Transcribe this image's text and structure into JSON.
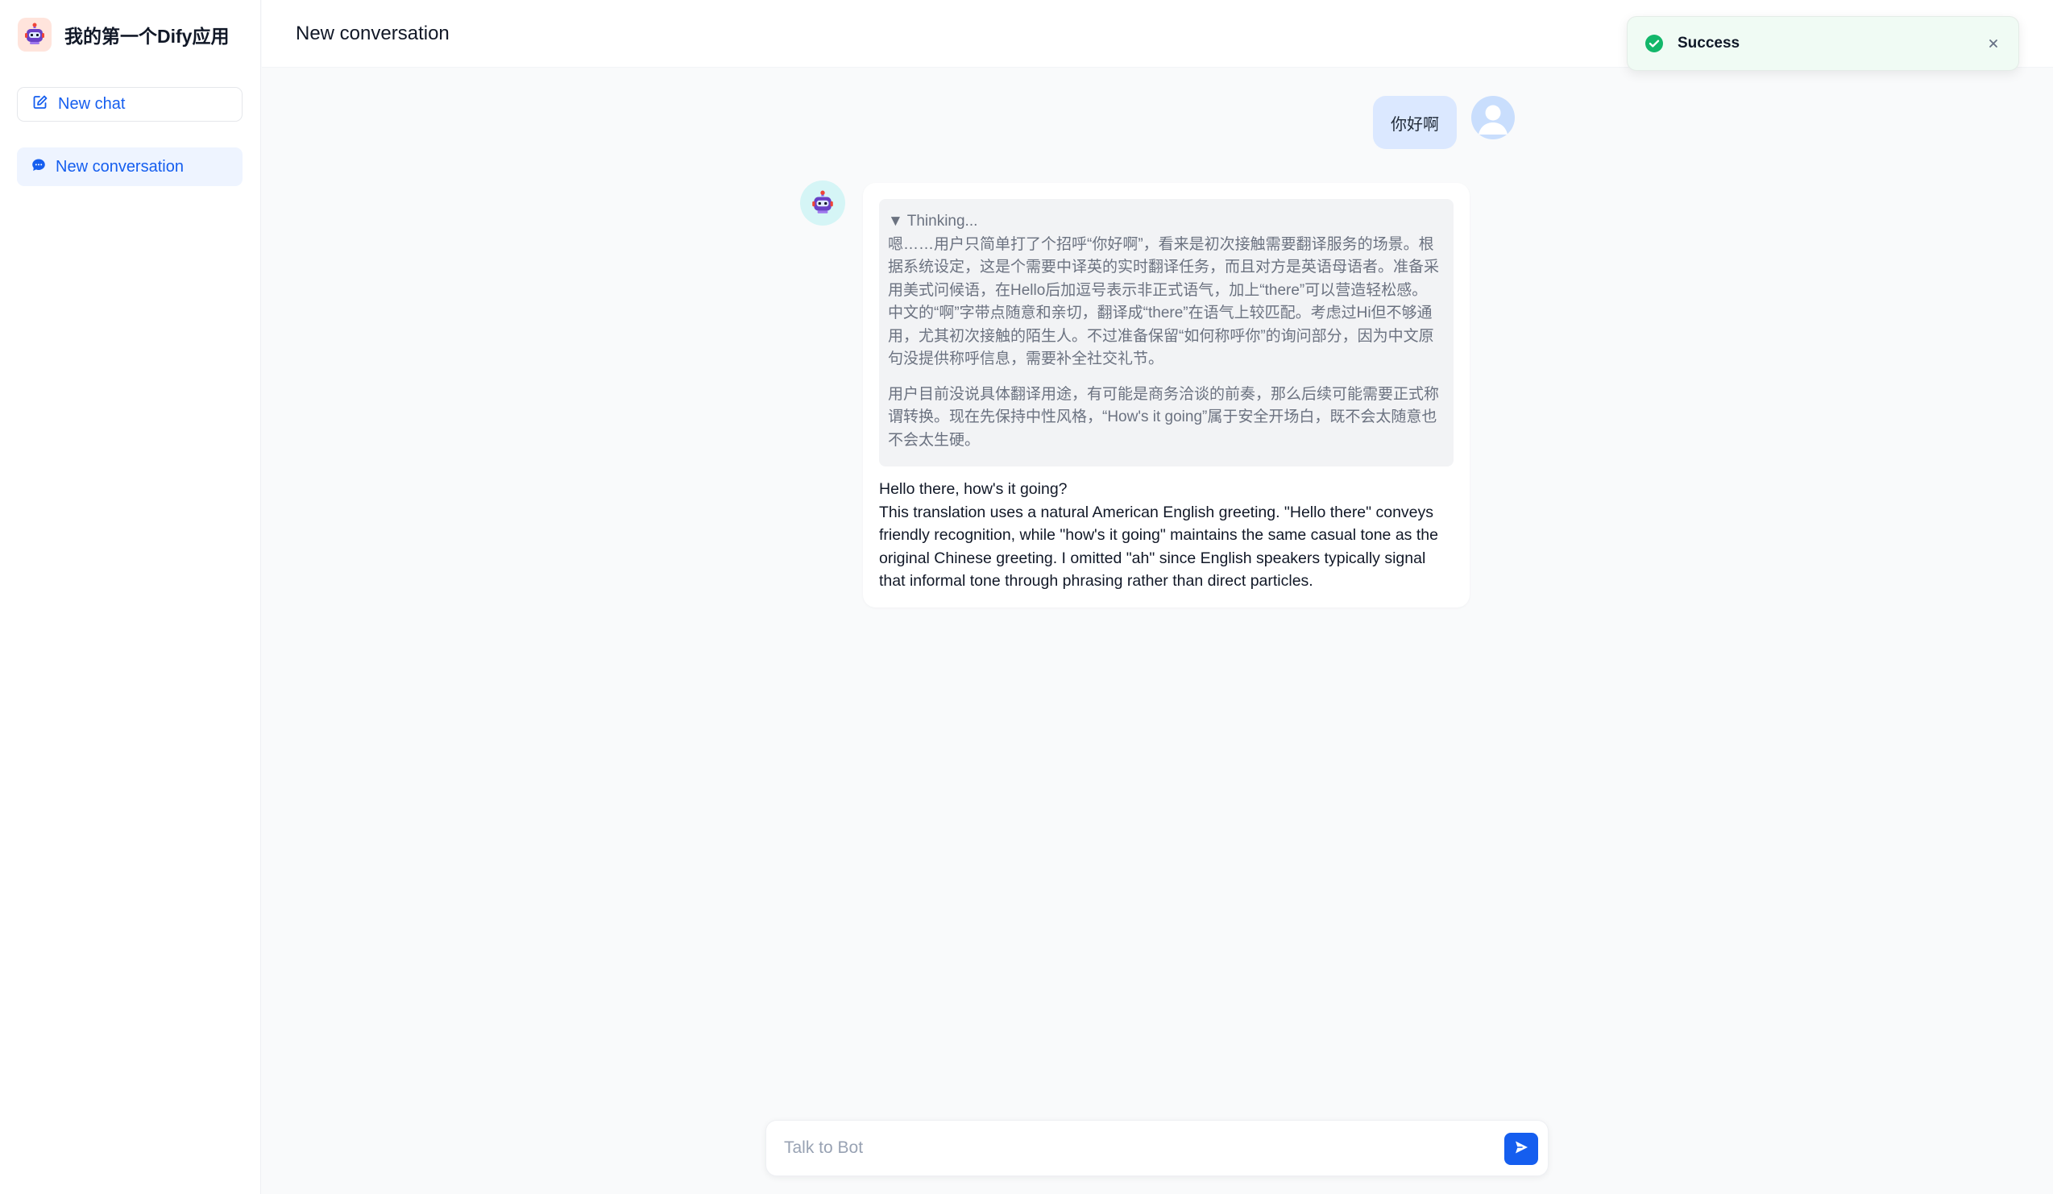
{
  "app": {
    "title": "我的第一个Dify应用",
    "logo_icon": "robot-icon"
  },
  "sidebar": {
    "new_chat_label": "New chat",
    "conversations": [
      {
        "label": "New conversation",
        "active": true
      }
    ]
  },
  "header": {
    "title": "New conversation"
  },
  "toast": {
    "message": "Success",
    "type": "success",
    "color": "#12b76a"
  },
  "messages": {
    "user": {
      "text": "你好啊"
    },
    "bot": {
      "thinking_label": "▼ Thinking...",
      "thinking_paragraphs": [
        "嗯……用户只简单打了个招呼“你好啊”，看来是初次接触需要翻译服务的场景。根据系统设定，这是个需要中译英的实时翻译任务，而且对方是英语母语者。准备采用美式问候语，在Hello后加逗号表示非正式语气，加上“there”可以营造轻松感。中文的“啊”字带点随意和亲切，翻译成“there”在语气上较匹配。考虑过Hi但不够通用，尤其初次接触的陌生人。不过准备保留“如何称呼你”的询问部分，因为中文原句没提供称呼信息，需要补全社交礼节。",
        "用户目前没说具体翻译用途，有可能是商务洽谈的前奏，那么后续可能需要正式称谓转换。现在先保持中性风格，“How's it going”属于安全开场白，既不会太随意也不会太生硬。"
      ],
      "answer_line1": "Hello there, how's it going?",
      "answer_line2": "This translation uses a natural American English greeting. \"Hello there\" conveys friendly recognition, while \"how's it going\" maintains the same casual tone as the original Chinese greeting. I omitted \"ah\" since English speakers typically signal that informal tone through phrasing rather than direct particles."
    }
  },
  "input": {
    "placeholder": "Talk to Bot",
    "value": ""
  },
  "colors": {
    "accent": "#155eef",
    "active_item_bg": "#eef4ff",
    "user_bubble_bg": "#dbe8ff",
    "toast_bg": "#f0fbf4"
  }
}
